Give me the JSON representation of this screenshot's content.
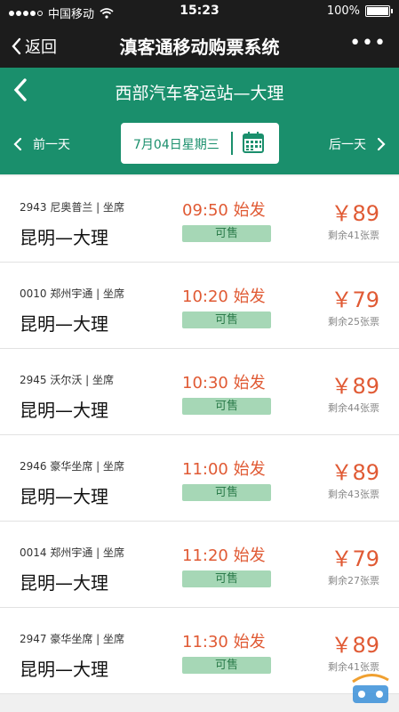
{
  "status": {
    "carrier": "中国移动",
    "time": "15:23",
    "battery": "100%"
  },
  "wechat": {
    "back_label": "返回",
    "title": "滇客通移动购票系统",
    "more": "•••"
  },
  "header": {
    "station": "西部汽车客运站—大理",
    "prev_label": "前一天",
    "next_label": "后一天",
    "date": "7月04日星期三"
  },
  "trips": [
    {
      "code": "2943  尼奥普兰 | 坐席",
      "route": "昆明—大理",
      "time": "09:50 始发",
      "status": "可售",
      "price": "￥89",
      "remain": "剩余41张票"
    },
    {
      "code": "0010  郑州宇通 | 坐席",
      "route": "昆明—大理",
      "time": "10:20 始发",
      "status": "可售",
      "price": "￥79",
      "remain": "剩余25张票"
    },
    {
      "code": "2945  沃尔沃 | 坐席",
      "route": "昆明—大理",
      "time": "10:30 始发",
      "status": "可售",
      "price": "￥89",
      "remain": "剩余44张票"
    },
    {
      "code": "2946  豪华坐席 | 坐席",
      "route": "昆明—大理",
      "time": "11:00 始发",
      "status": "可售",
      "price": "￥89",
      "remain": "剩余43张票"
    },
    {
      "code": "0014  郑州宇通 | 坐席",
      "route": "昆明—大理",
      "time": "11:20 始发",
      "status": "可售",
      "price": "￥79",
      "remain": "剩余27张票"
    },
    {
      "code": "2947  豪华坐席 | 坐席",
      "route": "昆明—大理",
      "time": "11:30 始发",
      "status": "可售",
      "price": "￥89",
      "remain": "剩余41张票"
    }
  ],
  "colors": {
    "brand_green": "#1a8f6c",
    "accent_orange": "#e05a34",
    "badge_green": "#a6d7b6"
  },
  "icons": {
    "back": "chevron-left-icon",
    "calendar": "calendar-icon",
    "wifi": "wifi-icon",
    "battery": "battery-icon"
  }
}
